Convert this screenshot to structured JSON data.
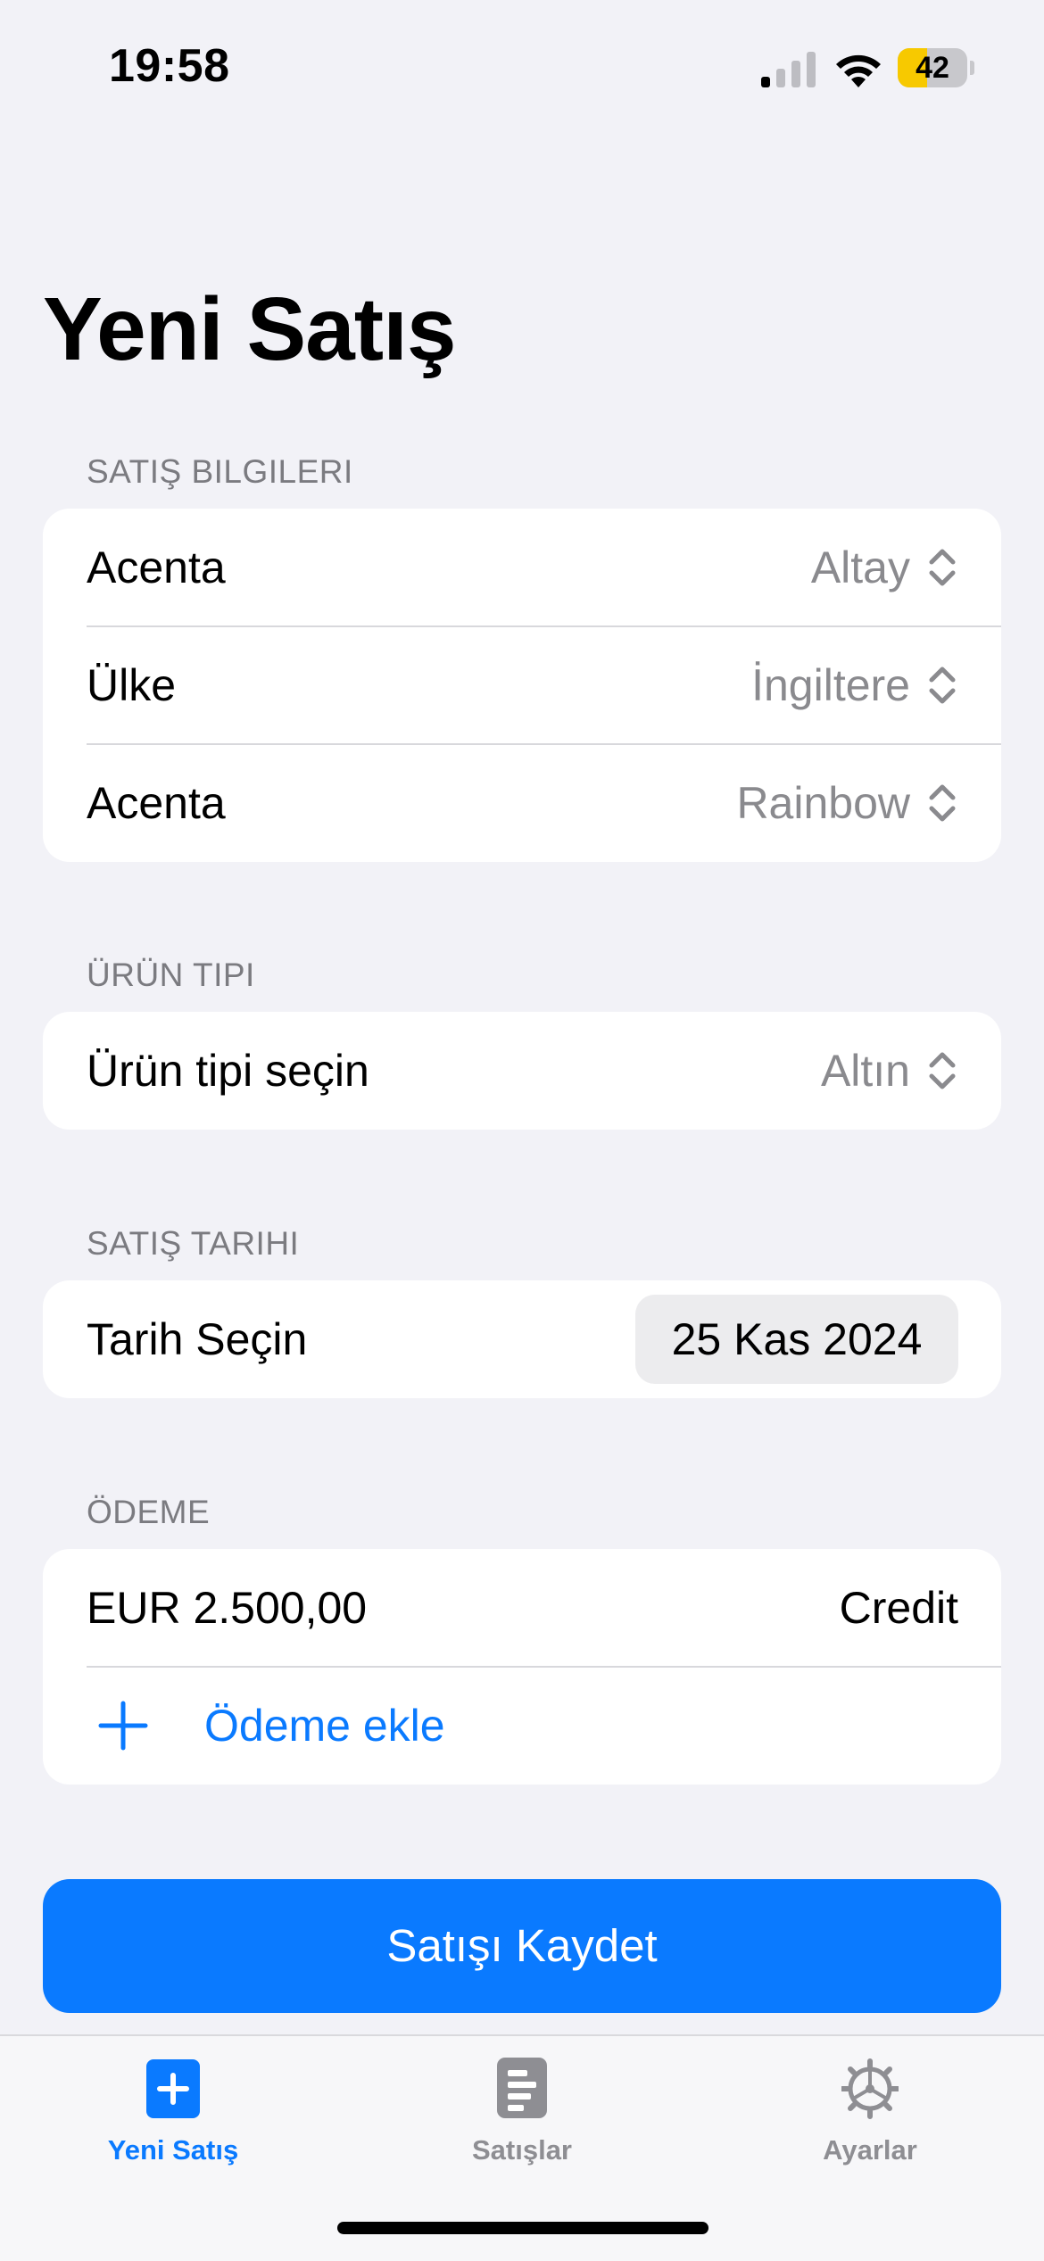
{
  "status_bar": {
    "time": "19:58",
    "battery_level": "42",
    "battery_fraction": 0.42
  },
  "page": {
    "title": "Yeni Satış"
  },
  "sections": {
    "sale_info": {
      "header": "SATIŞ BILGILERI",
      "rows": [
        {
          "label": "Acenta",
          "value": "Altay"
        },
        {
          "label": "Ülke",
          "value": "İngiltere"
        },
        {
          "label": "Acenta",
          "value": "Rainbow"
        }
      ]
    },
    "product_type": {
      "header": "ÜRÜN TIPI",
      "row": {
        "label": "Ürün tipi seçin",
        "value": "Altın"
      }
    },
    "sale_date": {
      "header": "SATIŞ TARIHI",
      "row": {
        "label": "Tarih Seçin",
        "value": "25 Kas 2024"
      }
    },
    "payment": {
      "header": "ÖDEME",
      "entry": {
        "amount": "EUR 2.500,00",
        "method": "Credit"
      },
      "add_label": "Ödeme ekle"
    }
  },
  "save_button": {
    "label": "Satışı Kaydet"
  },
  "tabbar": {
    "tabs": [
      {
        "label": "Yeni Satış",
        "icon": "plus-square-icon",
        "active": true
      },
      {
        "label": "Satışlar",
        "icon": "document-list-icon",
        "active": false
      },
      {
        "label": "Ayarlar",
        "icon": "gear-icon",
        "active": false
      }
    ]
  },
  "colors": {
    "accent": "#0a7aff",
    "background": "#f2f2f7",
    "secondary_text": "#8a8a8e",
    "battery": "#f7c900"
  }
}
